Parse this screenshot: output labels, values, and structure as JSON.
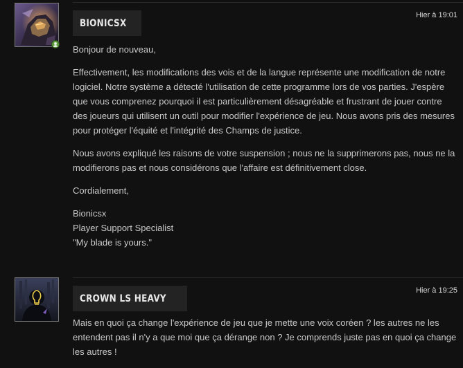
{
  "posts": [
    {
      "author": "Bionicsx",
      "timestamp": "Hier à 19:01",
      "avatar_icon": "champion-avatar-icon",
      "online_badge_icon": "user-online-icon",
      "paragraphs": [
        "Bonjour de nouveau,",
        "Effectivement, les modifications des vois et de la langue représente une modification de notre logiciel. Notre système a détecté l'utilisation de cette programme lors de vos parties. J'espère que vous comprenez pourquoi il est particulièrement désagréable et frustrant de jouer contre des joueurs qui utilisent un outil pour modifier l'expérience de jeu. Nous avons pris des mesures pour protéger l'équité et l'intégrité des Champs de justice.",
        "Nous avons expliqué les raisons de votre suspension ; nous ne la supprimerons pas, nous ne la modifierons pas et nous considérons que l'affaire est définitivement close.",
        "Cordialement,"
      ],
      "signature": [
        "Bionicsx",
        "Player Support Specialist",
        "\"My blade is yours.\""
      ]
    },
    {
      "author": "Crown LS Heavy",
      "timestamp": "Hier à 19:25",
      "avatar_icon": "lightbulb-avatar-icon",
      "paragraphs": [
        "Mais en quoi ça change l'expérience de jeu que je mette une voix coréen ? les autres ne les entendent pas il n'y a que moi que ça dérange non ? Je comprends juste pas en quoi ça change les autres !"
      ]
    }
  ],
  "colors": {
    "background": "#111111",
    "name_plate": "#232323",
    "body_text": "#c9c9c9",
    "online_badge": "#5d9b3c"
  }
}
